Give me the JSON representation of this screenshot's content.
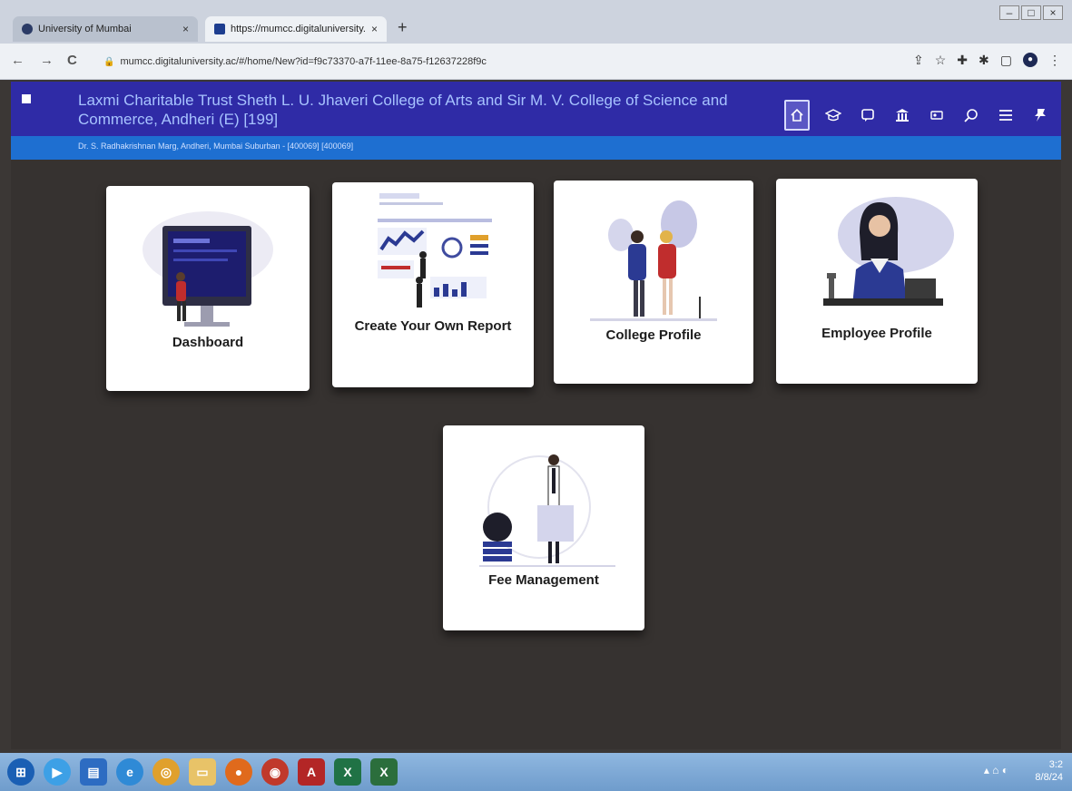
{
  "browser": {
    "tabs": [
      {
        "label": "University of Mumbai",
        "close": "×"
      },
      {
        "label": "https://mumcc.digitaluniversity...",
        "close": "×"
      }
    ],
    "new_tab": "+",
    "url": "mumcc.digitaluniversity.ac/#/home/New?id=f9c73370-a7f-11ee-8a75-f12637228f9c",
    "nav": {
      "back": "←",
      "forward": "→",
      "reload": "C"
    }
  },
  "header": {
    "college_name": "Laxmi Charitable Trust Sheth L. U. Jhaveri College of Arts and Sir M. V. College of Science and Commerce, Andheri (E) [199]",
    "address": "Dr. S. Radhakrishnan Marg, Andheri, Mumbai Suburban - [400069] [400069]",
    "icons": [
      "home-icon",
      "graduation-cap-icon",
      "chat-icon",
      "institution-icon",
      "id-card-icon",
      "search-icon",
      "menu-icon",
      "pin-icon"
    ]
  },
  "cards": [
    {
      "title": "Dashboard"
    },
    {
      "title": "Create Your Own Report"
    },
    {
      "title": "College Profile"
    },
    {
      "title": "Employee Profile"
    },
    {
      "title": "Fee Management"
    }
  ],
  "taskbar": {
    "clock_time": "3:2",
    "clock_date": "8/8/24"
  },
  "colors": {
    "header_bg": "#2f2ba6",
    "header_strip": "#1e6fd1",
    "page_bg": "#363230",
    "card_bg": "#ffffff"
  }
}
